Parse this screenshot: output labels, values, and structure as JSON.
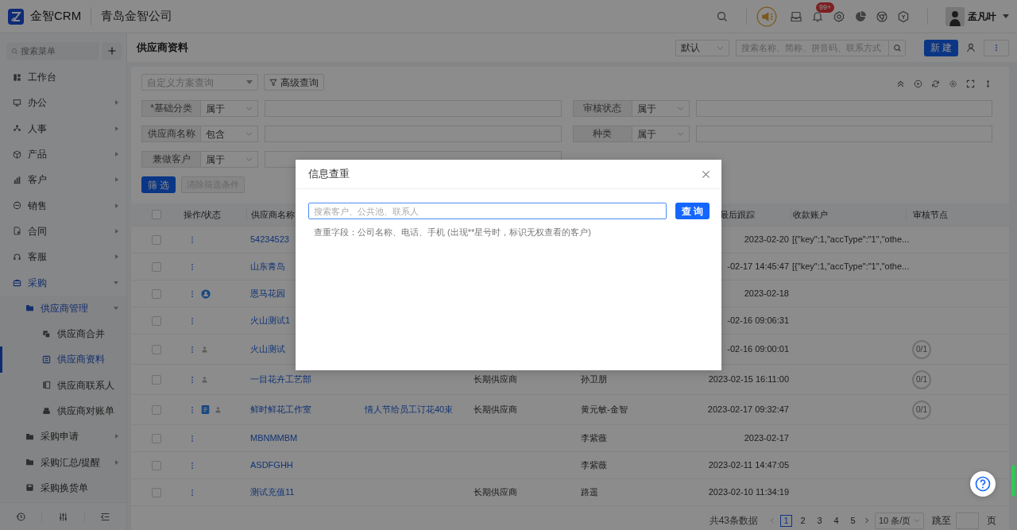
{
  "header": {
    "brand": "金智CRM",
    "company": "青岛金智公司",
    "notification_badge": "99+",
    "user": "孟凡叶"
  },
  "sidebar": {
    "search": {
      "placeholder": "搜索菜单"
    },
    "items": [
      {
        "label": "工作台",
        "selected": false
      },
      {
        "label": "办公",
        "expanded": false,
        "selected": false
      },
      {
        "label": "人事",
        "expanded": false,
        "selected": false
      },
      {
        "label": "产品",
        "expanded": false,
        "selected": false
      },
      {
        "label": "客户",
        "expanded": false,
        "selected": false
      },
      {
        "label": "销售",
        "expanded": false,
        "selected": false
      },
      {
        "label": "合同",
        "expanded": false,
        "selected": false
      },
      {
        "label": "客服",
        "expanded": false,
        "selected": false
      },
      {
        "label": "采购",
        "expanded": true,
        "selected": false,
        "children": [
          {
            "label": "供应商管理",
            "expanded": true,
            "selected": false,
            "children": [
              {
                "label": "供应商合并",
                "selected": false
              },
              {
                "label": "供应商资料",
                "selected": true
              },
              {
                "label": "供应商联系人",
                "selected": false
              },
              {
                "label": "供应商对账单",
                "selected": false
              }
            ]
          },
          {
            "label": "采购申请",
            "expanded": false,
            "selected": false
          },
          {
            "label": "采购汇总/提醒",
            "expanded": false,
            "selected": false
          },
          {
            "label": "采购换货单",
            "selected": false
          }
        ]
      }
    ]
  },
  "page": {
    "title": "供应商资料",
    "view_select": "默认",
    "search": {
      "placeholder": "搜索名称、简称、拼音码、联系方式"
    },
    "new_button": "新 建"
  },
  "filters": {
    "scheme": {
      "placeholder": "自定义方案查询"
    },
    "advanced_button": "高级查询",
    "fields": [
      {
        "label": "*基础分类",
        "operator": "属于"
      },
      {
        "label": "审核状态",
        "operator": "属于"
      },
      {
        "label": "供应商名称",
        "operator": "包含"
      },
      {
        "label": "种类",
        "operator": "属于"
      },
      {
        "label": "兼做客户",
        "operator": "属于"
      }
    ],
    "apply_button": "筛 选",
    "clear_button": {
      "label": "清除筛选条件",
      "disabled": true
    }
  },
  "table": {
    "header_checkbox": {
      "checked": false
    },
    "columns": [
      {
        "label": "操作/状态"
      },
      {
        "label": "供应商名称"
      },
      {
        "label": "最后跟踪"
      },
      {
        "label": "收款账户"
      },
      {
        "label": "审核节点"
      }
    ],
    "rows": [
      {
        "selected": false,
        "status_icons": [],
        "name": "54234523",
        "last_follow": "2023-02-20",
        "account": "[{\"key\":1,\"accType\":\"1\",\"othe..."
      },
      {
        "selected": false,
        "status_icons": [],
        "name": "山东青岛",
        "last_follow": "-02-17 14:45:47",
        "account": "[{\"key\":1,\"accType\":\"1\",\"othe..."
      },
      {
        "selected": false,
        "status_icons": [
          {
            "kind": "customer"
          }
        ],
        "name": "恩马花园",
        "last_follow": "2023-02-18"
      },
      {
        "selected": false,
        "status_icons": [],
        "name": "火山测试1",
        "last_follow": "-02-16 09:06:31"
      },
      {
        "selected": false,
        "status_icons": [
          {
            "kind": "contact"
          }
        ],
        "name": "火山测试",
        "last_follow": "-02-16 09:00:01",
        "audit": "0/1"
      },
      {
        "selected": false,
        "status_icons": [
          {
            "kind": "contact"
          }
        ],
        "name": "一目花卉工艺部",
        "column_5": "长期供应商",
        "column_6": "孙卫朋",
        "last_follow": "2023-02-15 16:11:00",
        "audit": "0/1"
      },
      {
        "selected": false,
        "status_icons": [
          {
            "kind": "doc"
          },
          {
            "kind": "contact"
          }
        ],
        "name": "鲜时鲜花工作室",
        "column_4": "情人节给员工订花40束",
        "column_5": "长期供应商",
        "column_6": "黄元敏-金智",
        "last_follow": "2023-02-17 09:32:47",
        "audit": "0/1"
      },
      {
        "selected": false,
        "status_icons": [],
        "name": "MBNMMBM",
        "column_6": "李紫薇",
        "last_follow": "2023-02-17"
      },
      {
        "selected": false,
        "status_icons": [],
        "name": "ASDFGHH",
        "column_6": "李紫薇",
        "last_follow": "2023-02-11 14:47:05"
      },
      {
        "selected": false,
        "status_icons": [],
        "name": "测试充值11",
        "column_5": "长期供应商",
        "column_6": "路遥",
        "last_follow": "2023-02-10 11:34:19"
      }
    ]
  },
  "pagination": {
    "total": "共43条数据",
    "pages": [
      {
        "label": "1",
        "selected": true
      },
      {
        "label": "2",
        "selected": false
      },
      {
        "label": "3",
        "selected": false
      },
      {
        "label": "4",
        "selected": false
      },
      {
        "label": "5",
        "selected": false
      }
    ],
    "page_size": "10 条/页",
    "jump_label": "跳至",
    "page_unit": "页"
  },
  "dialog": {
    "title": "信息查重",
    "search": {
      "placeholder": "搜索客户、公共池、联系人"
    },
    "search_button": "查 询",
    "hint": "查重字段：公司名称、电话、手机 (出现**星号时，标识无权查看的客户)"
  }
}
